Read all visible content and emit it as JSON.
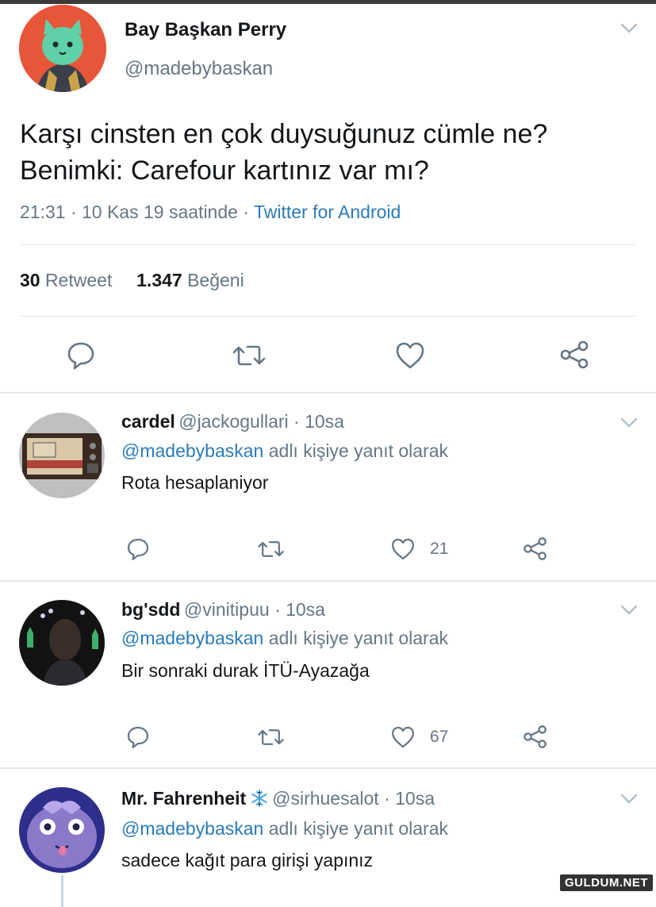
{
  "main_tweet": {
    "display_name": "Bay Başkan Perry",
    "handle": "@madebybaskan",
    "text_line1": "Karşı cinsten en çok duysuğunuz cümle ne?",
    "text_line2": "Benimki: Carefour kartınız var mı?",
    "time_date": "21:31 · 10 Kas 19 saatinde · ",
    "source": "Twitter for Android",
    "retweet_count": "30",
    "retweet_label": "Retweet",
    "like_count": "1.347",
    "like_label": "Beğeni"
  },
  "replies": [
    {
      "display_name": "cardel",
      "meta": "@jackogullari · 10sa",
      "mention": "@madebybaskan",
      "reply_suffix": " adlı kişiye yanıt olarak",
      "text": "Rota hesaplaniyor",
      "like_count": "21"
    },
    {
      "display_name": "bg'sdd",
      "meta": "@vinitipuu · 10sa",
      "mention": "@madebybaskan",
      "reply_suffix": " adlı kişiye yanıt olarak",
      "text": "Bir sonraki durak İTÜ-Ayazağa",
      "like_count": "67"
    },
    {
      "display_name": "Mr. Fahrenheit",
      "meta": "@sirhuesalot · 10sa",
      "mention": "@madebybaskan",
      "reply_suffix": " adlı kişiye yanıt olarak",
      "text": "sadece kağıt para girişi yapınız"
    }
  ],
  "watermark": "GULDUM.NET",
  "colors": {
    "link": "#2b7bb9",
    "secondary_text": "#657786",
    "divider": "#e1e8ed",
    "main_avatar_bg": "#e8563a"
  },
  "icons": [
    "reply-icon",
    "retweet-icon",
    "like-icon",
    "share-icon",
    "chevron-down-icon",
    "snowflake-icon"
  ]
}
